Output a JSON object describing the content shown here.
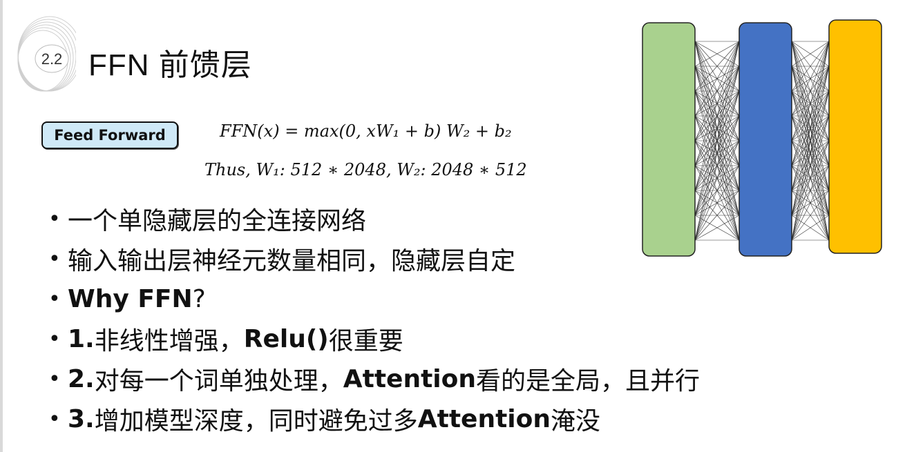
{
  "header": {
    "section_number": "2.2",
    "title": "FFN 前馈层"
  },
  "badge": {
    "label": "Feed Forward"
  },
  "formulas": {
    "ffn": "FFN(x) = max(0, xW₁ + b) W₂ + b₂",
    "shapes": "Thus, W₁: 512 ∗ 2048,  W₂: 2048 ∗ 512"
  },
  "bullets": [
    {
      "plain": "一个单隐藏层的全连接网络"
    },
    {
      "plain": "输入输出层神经元数量相同，隐藏层自定"
    },
    {
      "bold": "Why FFN",
      "rest": "?"
    },
    {
      "num": "1.",
      "pre": " 非线性增强，",
      "bold": "Relu()",
      "rest": " 很重要"
    },
    {
      "num": "2.",
      "pre": " 对每一个词单独处理，",
      "bold": "Attention",
      "rest": " 看的是全局，且并行"
    },
    {
      "num": "3.",
      "pre": " 增加模型深度，同时避免过多",
      "bold": "Attention",
      "rest": "淹没"
    }
  ],
  "diagram": {
    "layers": [
      {
        "name": "input",
        "color": "#a9d18e"
      },
      {
        "name": "hidden",
        "color": "#4472c4"
      },
      {
        "name": "output",
        "color": "#ffc000"
      }
    ]
  }
}
